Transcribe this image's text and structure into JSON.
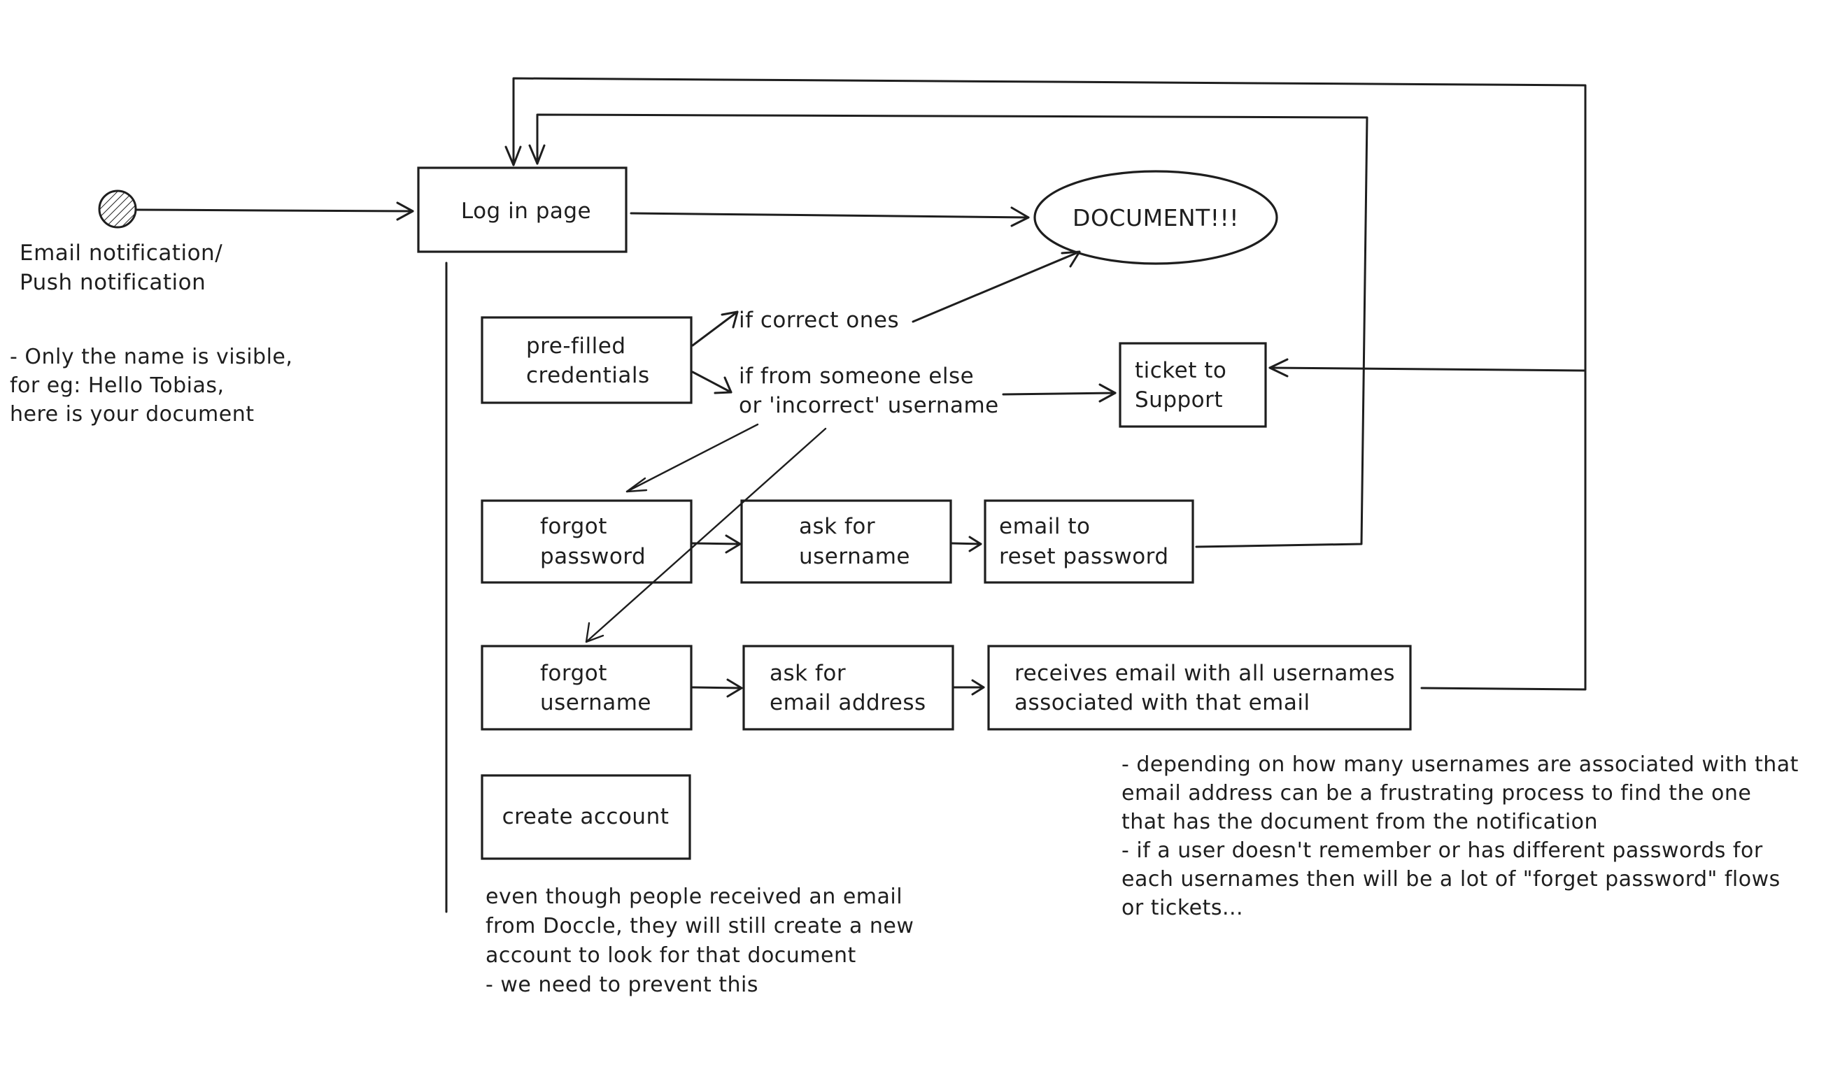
{
  "diagram": {
    "type": "user-flow",
    "colors": {
      "stroke": "#1e1e1e",
      "background": "#ffffff"
    },
    "start": {
      "label_lines": [
        "Email notification/",
        "Push notification"
      ]
    },
    "nodes": {
      "login": {
        "lines": [
          "Log in page"
        ]
      },
      "document": {
        "lines": [
          "DOCUMENT!!!"
        ]
      },
      "prefilled": {
        "lines": [
          "pre-filled",
          "credentials"
        ]
      },
      "ticket": {
        "lines": [
          "ticket to",
          "Support"
        ]
      },
      "forgot_password": {
        "lines": [
          "forgot",
          "password"
        ]
      },
      "ask_username": {
        "lines": [
          "ask for",
          "username"
        ]
      },
      "email_reset": {
        "lines": [
          "email to",
          "reset password"
        ]
      },
      "forgot_username": {
        "lines": [
          "forgot",
          "username"
        ]
      },
      "ask_email": {
        "lines": [
          "ask for",
          "email address"
        ]
      },
      "receives_email": {
        "lines": [
          "receives email with all usernames",
          "associated with that email"
        ]
      },
      "create_account": {
        "lines": [
          "create account"
        ]
      }
    },
    "edge_labels": {
      "correct": [
        "if correct ones"
      ],
      "someone_else": [
        "if from someone else",
        "or 'incorrect' username"
      ]
    },
    "notes": {
      "start_note": [
        "- Only the name is visible,",
        "for eg: Hello Tobias,",
        "here is your document"
      ],
      "create_note": [
        "even though people received an email",
        "from Doccle, they will still create a new",
        "account to look for that document",
        "- we need to prevent this"
      ],
      "usernames_note": [
        "- depending on how many usernames are associated with that",
        "email address can be a frustrating  process to find the one",
        "that has the document from the notification",
        "- if a user doesn't remember or has different passwords for",
        "each usernames then will be a lot of \"forget password\" flows",
        "or tickets..."
      ]
    }
  }
}
